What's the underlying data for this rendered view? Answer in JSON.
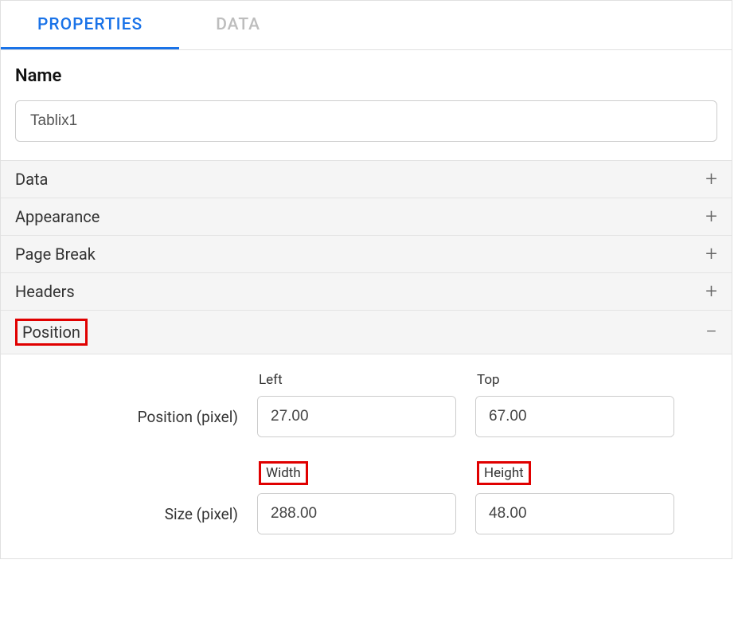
{
  "tabs": {
    "properties": "PROPERTIES",
    "data": "DATA"
  },
  "name": {
    "label": "Name",
    "value": "Tablix1"
  },
  "sections": {
    "data": "Data",
    "appearance": "Appearance",
    "pageBreak": "Page Break",
    "headers": "Headers",
    "position": "Position"
  },
  "position": {
    "positionRowLabel": "Position (pixel)",
    "sizeRowLabel": "Size (pixel)",
    "left": {
      "label": "Left",
      "value": "27.00"
    },
    "top": {
      "label": "Top",
      "value": "67.00"
    },
    "width": {
      "label": "Width",
      "value": "288.00"
    },
    "height": {
      "label": "Height",
      "value": "48.00"
    }
  },
  "icons": {
    "plus": "+",
    "minus": "−"
  }
}
